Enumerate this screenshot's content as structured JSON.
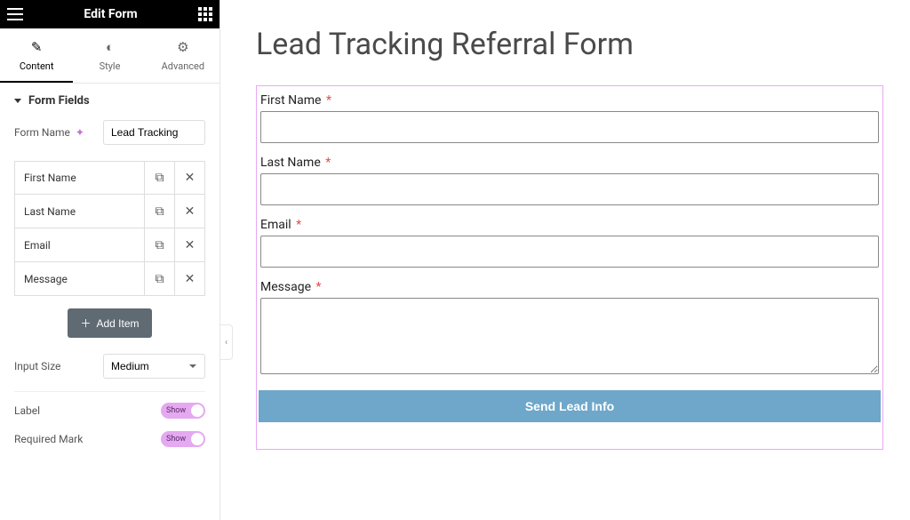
{
  "header": {
    "title": "Edit Form"
  },
  "tabs": {
    "content": "Content",
    "style": "Style",
    "advanced": "Advanced"
  },
  "section": {
    "form_fields_title": "Form Fields",
    "form_name_label": "Form Name",
    "form_name_value": "Lead Tracking",
    "add_item_label": "Add Item",
    "input_size_label": "Input Size",
    "input_size_value": "Medium",
    "label_label": "Label",
    "label_toggle_text": "Show",
    "required_mark_label": "Required Mark",
    "required_mark_toggle_text": "Show"
  },
  "fields": [
    {
      "label": "First Name"
    },
    {
      "label": "Last Name"
    },
    {
      "label": "Email"
    },
    {
      "label": "Message"
    }
  ],
  "preview": {
    "title": "Lead Tracking Referral Form",
    "submit_label": "Send Lead Info",
    "required_marker": "*",
    "f1_label": "First Name",
    "f2_label": "Last Name",
    "f3_label": "Email",
    "f4_label": "Message"
  }
}
